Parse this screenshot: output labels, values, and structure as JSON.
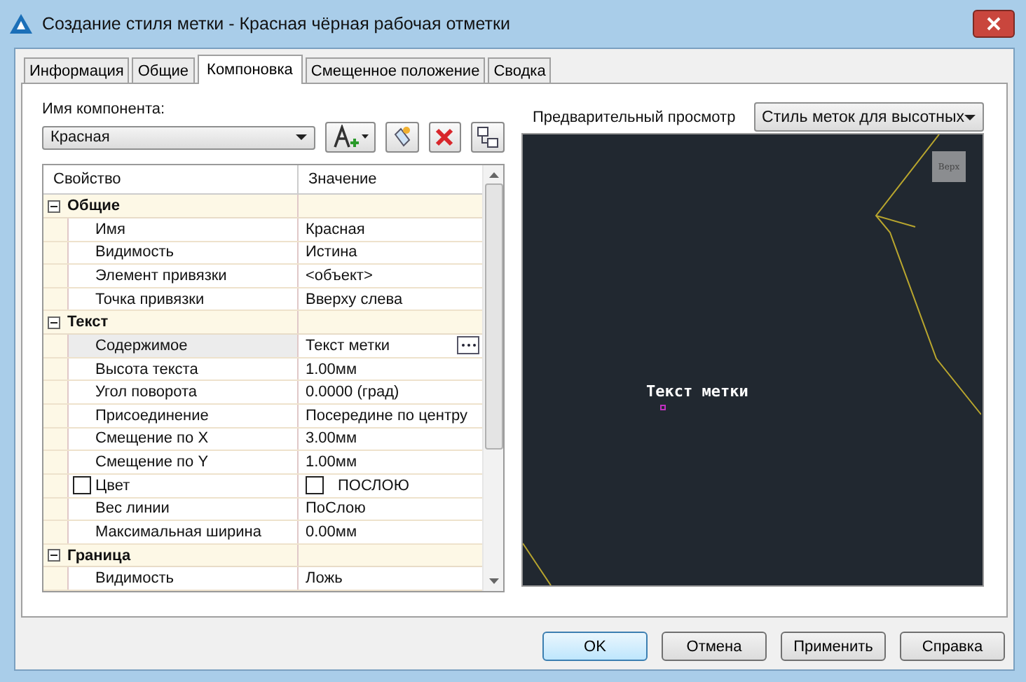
{
  "window": {
    "title": "Создание стиля метки - Красная чёрная рабочая отметки"
  },
  "tabs": [
    {
      "label": "Информация",
      "selected": false
    },
    {
      "label": "Общие",
      "selected": false
    },
    {
      "label": "Компоновка",
      "selected": true
    },
    {
      "label": "Смещенное положение",
      "selected": false
    },
    {
      "label": "Сводка",
      "selected": false
    }
  ],
  "component": {
    "label": "Имя компонента:",
    "value": "Красная"
  },
  "property_grid": {
    "columns": [
      "Свойство",
      "Значение"
    ],
    "groups": [
      {
        "name": "Общие",
        "expanded": true,
        "rows": [
          {
            "name": "Имя",
            "value": "Красная",
            "kind": "text",
            "selected": false
          },
          {
            "name": "Видимость",
            "value": "Истина",
            "kind": "text",
            "selected": false
          },
          {
            "name": "Элемент привязки",
            "value": "<объект>",
            "kind": "text",
            "selected": false
          },
          {
            "name": "Точка привязки",
            "value": "Вверху слева",
            "kind": "text",
            "selected": false
          }
        ]
      },
      {
        "name": "Текст",
        "expanded": true,
        "rows": [
          {
            "name": "Содержимое",
            "value": "Текст метки",
            "kind": "browse",
            "selected": true
          },
          {
            "name": "Высота текста",
            "value": "1.00мм",
            "kind": "text",
            "selected": false
          },
          {
            "name": "Угол поворота",
            "value": "0.0000 (град)",
            "kind": "text",
            "selected": false
          },
          {
            "name": "Присоединение",
            "value": "Посередине по центру",
            "kind": "text",
            "selected": false
          },
          {
            "name": "Смещение по X",
            "value": "3.00мм",
            "kind": "text",
            "selected": false
          },
          {
            "name": "Смещение по Y",
            "value": "1.00мм",
            "kind": "text",
            "selected": false
          },
          {
            "name": "Цвет",
            "value": "ПОСЛОЮ",
            "kind": "color",
            "color": "#ffffff",
            "selected": false
          },
          {
            "name": "Вес линии",
            "value": "ПоСлою",
            "kind": "text",
            "selected": false
          },
          {
            "name": "Максимальная ширина",
            "value": "0.00мм",
            "kind": "text",
            "selected": false
          }
        ]
      },
      {
        "name": "Граница",
        "expanded": true,
        "rows": [
          {
            "name": "Видимость",
            "value": "Ложь",
            "kind": "text",
            "selected": false
          }
        ]
      }
    ]
  },
  "preview": {
    "label": "Предварительный просмотр",
    "style": "Стиль меток для высотных",
    "label_text": "Текст метки",
    "view_cube": "Верх"
  },
  "buttons": [
    {
      "label": "OK",
      "default": true
    },
    {
      "label": "Отмена",
      "default": false
    },
    {
      "label": "Применить",
      "default": false
    },
    {
      "label": "Справка",
      "default": false
    }
  ]
}
